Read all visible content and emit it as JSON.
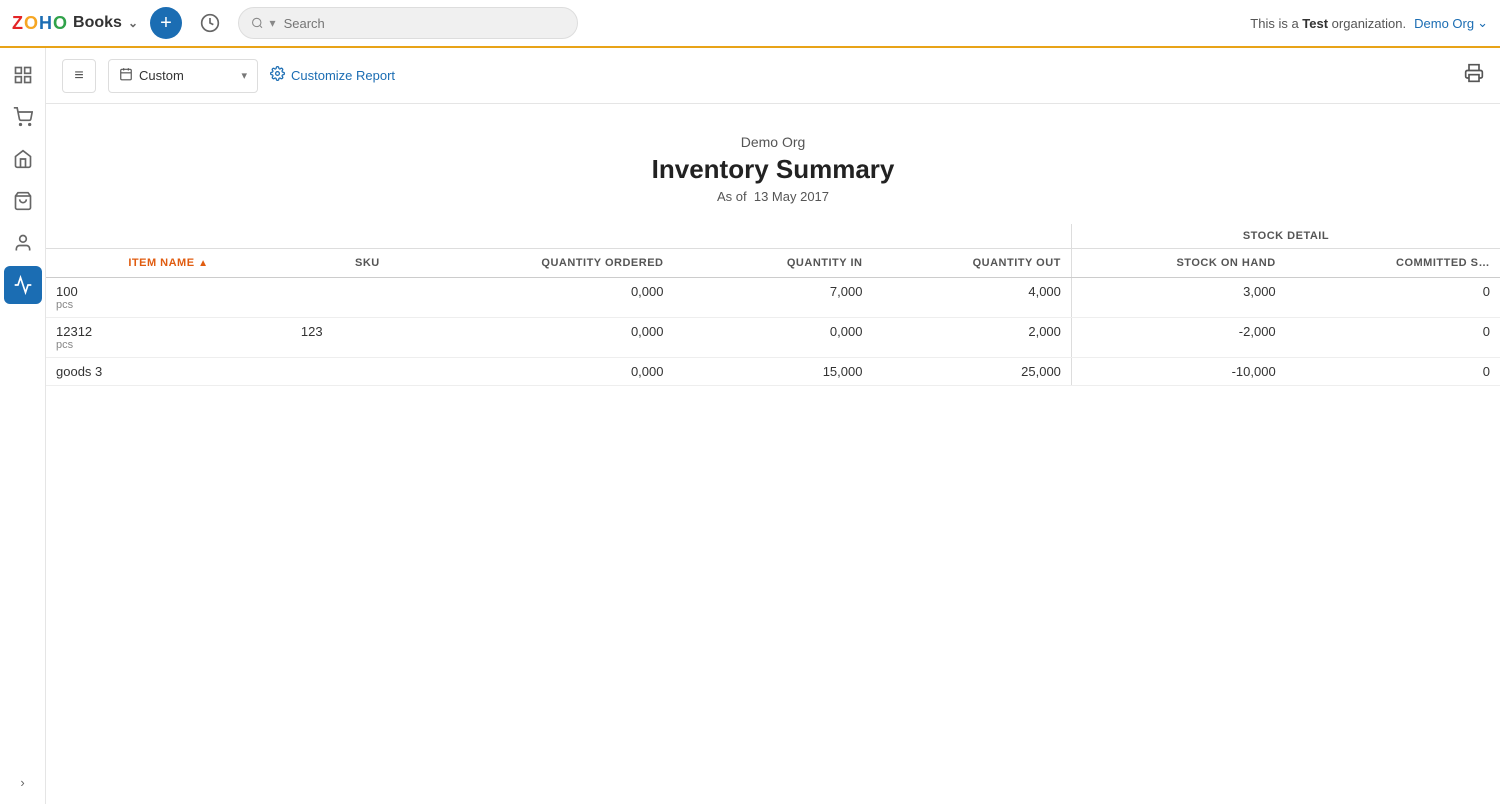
{
  "app": {
    "logo_z": "Z",
    "logo_o1": "O",
    "logo_h": "H",
    "logo_o2": "O",
    "logo_books": "Books",
    "logo_chevron": "⌄",
    "add_button_label": "+",
    "search_placeholder": "Search",
    "org_message_prefix": "This is a ",
    "org_message_test": "Test",
    "org_message_suffix": " organization.",
    "demo_org_label": "Demo Org",
    "demo_org_chevron": "⌄"
  },
  "toolbar": {
    "menu_icon": "≡",
    "custom_label": "Custom",
    "dropdown_chevron": "▾",
    "customize_label": "Customize Report",
    "print_icon": "⎙"
  },
  "report": {
    "org_name": "Demo Org",
    "title": "Inventory Summary",
    "as_of_label": "As of",
    "date": "13 May 2017"
  },
  "table": {
    "stock_detail_header": "STOCK DETAIL",
    "columns": [
      {
        "id": "item_name",
        "label": "ITEM NAME",
        "sortable": true,
        "align": "left"
      },
      {
        "id": "sku",
        "label": "SKU",
        "sortable": false,
        "align": "left"
      },
      {
        "id": "qty_ordered",
        "label": "QUANTITY ORDERED",
        "sortable": false,
        "align": "right"
      },
      {
        "id": "qty_in",
        "label": "QUANTITY IN",
        "sortable": false,
        "align": "right"
      },
      {
        "id": "qty_out",
        "label": "QUANTITY OUT",
        "sortable": false,
        "align": "right"
      },
      {
        "id": "stock_on_hand",
        "label": "STOCK ON HAND",
        "sortable": false,
        "align": "right"
      },
      {
        "id": "committed_stock",
        "label": "COMMITTED S…",
        "sortable": false,
        "align": "right"
      }
    ],
    "rows": [
      {
        "item_name": "100",
        "unit": "pcs",
        "sku": "",
        "qty_ordered": "0,000",
        "qty_in": "7,000",
        "qty_out": "4,000",
        "stock_on_hand": "3,000",
        "committed_stock": "0"
      },
      {
        "item_name": "12312",
        "unit": "pcs",
        "sku": "123",
        "qty_ordered": "0,000",
        "qty_in": "0,000",
        "qty_out": "2,000",
        "stock_on_hand": "-2,000",
        "committed_stock": "0"
      },
      {
        "item_name": "goods 3",
        "unit": "",
        "sku": "",
        "qty_ordered": "0,000",
        "qty_in": "15,000",
        "qty_out": "25,000",
        "stock_on_hand": "-10,000",
        "committed_stock": "0"
      }
    ]
  },
  "sidebar": {
    "items": [
      {
        "id": "dashboard",
        "icon": "⊞",
        "label": "Dashboard"
      },
      {
        "id": "sales",
        "icon": "🛒",
        "label": "Sales"
      },
      {
        "id": "purchases",
        "icon": "🏢",
        "label": "Purchases"
      },
      {
        "id": "inventory",
        "icon": "📦",
        "label": "Inventory"
      },
      {
        "id": "contacts",
        "icon": "👤",
        "label": "Contacts"
      },
      {
        "id": "reports",
        "icon": "📊",
        "label": "Reports",
        "active": true
      }
    ],
    "expand_label": "›"
  }
}
